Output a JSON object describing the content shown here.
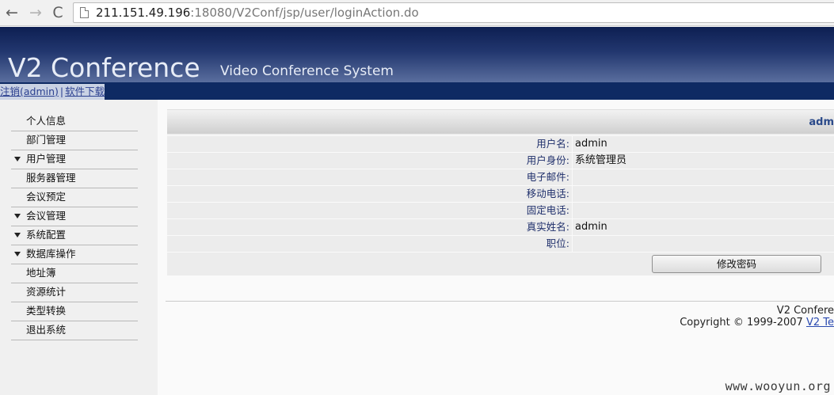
{
  "browser": {
    "url_host": "211.151.49.196",
    "url_rest": ":18080/V2Conf/jsp/user/loginAction.do",
    "back_glyph": "←",
    "forward_glyph": "→",
    "reload_glyph": "C"
  },
  "header": {
    "title": "V2 Conference",
    "subtitle": "Video Conference System"
  },
  "top_links": {
    "logout": "注销(admin)",
    "separator": "|",
    "download": "软件下载"
  },
  "sidebar": {
    "items": [
      {
        "label": "个人信息",
        "expandable": false
      },
      {
        "label": "部门管理",
        "expandable": false
      },
      {
        "label": "用户管理",
        "expandable": true
      },
      {
        "label": "服务器管理",
        "expandable": false
      },
      {
        "label": "会议预定",
        "expandable": false
      },
      {
        "label": "会议管理",
        "expandable": true
      },
      {
        "label": "系统配置",
        "expandable": true
      },
      {
        "label": "数据库操作",
        "expandable": true
      },
      {
        "label": "地址簿",
        "expandable": false
      },
      {
        "label": "资源统计",
        "expandable": false
      },
      {
        "label": "类型转换",
        "expandable": false
      },
      {
        "label": "退出系统",
        "expandable": false
      }
    ]
  },
  "profile": {
    "header": "adm",
    "rows": [
      {
        "label": "用户名:",
        "value": "admin"
      },
      {
        "label": "用户身份:",
        "value": "系统管理员"
      },
      {
        "label": "电子邮件:",
        "value": ""
      },
      {
        "label": "移动电话:",
        "value": ""
      },
      {
        "label": "固定电话:",
        "value": ""
      },
      {
        "label": "真实姓名:",
        "value": "admin"
      },
      {
        "label": "职位:",
        "value": ""
      }
    ],
    "change_password_label": "修改密码"
  },
  "footer": {
    "line1": "V2 Confere",
    "copyright": "Copyright © 1999-2007 ",
    "company_link": "V2 Te"
  },
  "watermark": "www.wooyun.org"
}
